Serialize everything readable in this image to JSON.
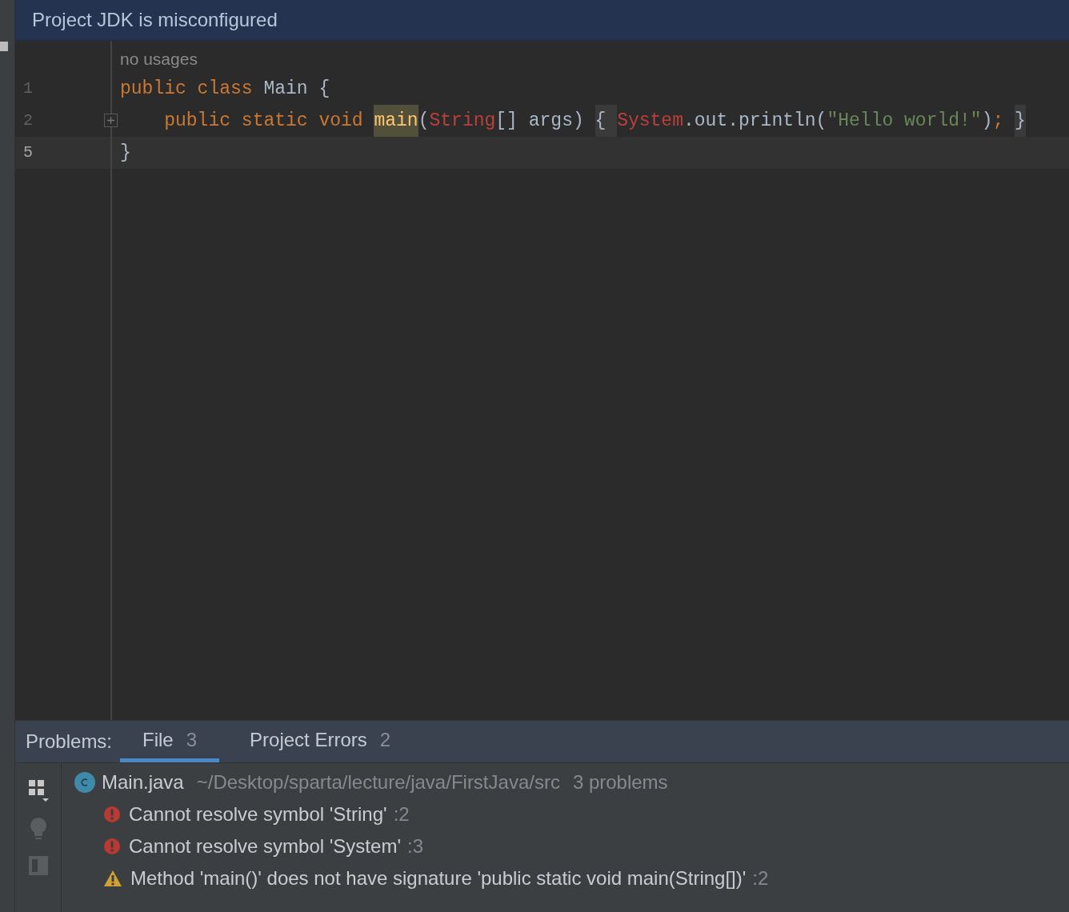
{
  "banner": {
    "title": "Project JDK is misconfigured"
  },
  "editor": {
    "hint": "no usages",
    "lines": [
      {
        "number": "1",
        "current": false,
        "folded": false,
        "tokens": [
          {
            "text": "public class ",
            "kind": "keyword"
          },
          {
            "text": "Main {",
            "kind": "plain"
          }
        ]
      },
      {
        "number": "2",
        "current": false,
        "folded": true,
        "tokens": [
          {
            "text": "    public static void ",
            "kind": "keyword"
          },
          {
            "text": "main",
            "kind": "highlight"
          },
          {
            "text": "(",
            "kind": "plain"
          },
          {
            "text": "String",
            "kind": "error"
          },
          {
            "text": "[] args) ",
            "kind": "plain"
          },
          {
            "text": "{ ",
            "kind": "fold"
          },
          {
            "text": "System",
            "kind": "error"
          },
          {
            "text": ".out.println(",
            "kind": "plain"
          },
          {
            "text": "\"Hello world!\"",
            "kind": "string"
          },
          {
            "text": ")",
            "kind": "plain"
          },
          {
            "text": "; ",
            "kind": "keyword"
          },
          {
            "text": "}",
            "kind": "fold"
          }
        ]
      },
      {
        "number": "5",
        "current": true,
        "folded": false,
        "tokens": [
          {
            "text": "}",
            "kind": "plain"
          }
        ]
      }
    ]
  },
  "problems": {
    "label": "Problems:",
    "tabs": [
      {
        "label": "File",
        "count": "3",
        "selected": true
      },
      {
        "label": "Project Errors",
        "count": "2",
        "selected": false
      }
    ],
    "file": {
      "name": "Main.java",
      "path": "~/Desktop/sparta/lecture/java/FirstJava/src",
      "summary": "3 problems"
    },
    "items": [
      {
        "kind": "error",
        "message": "Cannot resolve symbol 'String'",
        "line": ":2"
      },
      {
        "kind": "error",
        "message": "Cannot resolve symbol 'System'",
        "line": ":3"
      },
      {
        "kind": "warning",
        "message": "Method 'main()' does not have signature 'public static void main(String[])'",
        "line": ":2"
      }
    ]
  }
}
